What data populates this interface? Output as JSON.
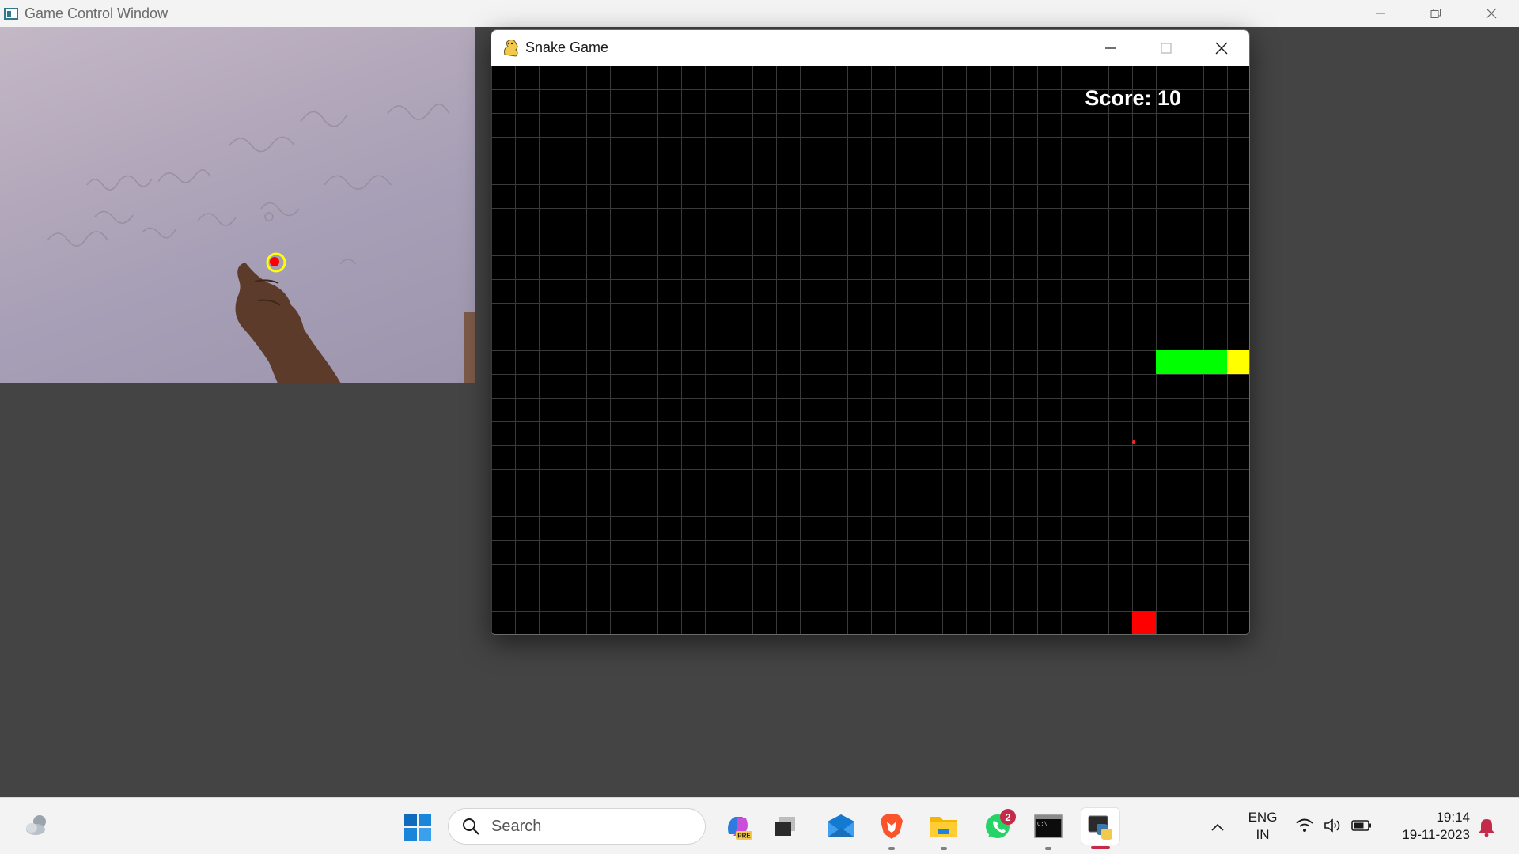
{
  "desktop": {
    "background_color": "#444444"
  },
  "control_window": {
    "title": "Game Control Window",
    "icon": "opencv-window-icon",
    "controls": [
      "minimize-icon",
      "restore-icon",
      "close-icon"
    ]
  },
  "camera_feed": {
    "description_icon": "webcam-feed",
    "tracker_color": "#ffff00",
    "tracker_dot_color": "#ff0000"
  },
  "snake_window": {
    "title": "Snake Game",
    "icon": "pygame-snake-icon",
    "controls": [
      "minimize-icon",
      "maximize-icon",
      "close-icon"
    ],
    "score_label": "Score: 10",
    "colors": {
      "board": "#000000",
      "grid": "#3a3a3a",
      "snake_body": "#00ff00",
      "snake_head": "#ffff00",
      "food": "#ff0000",
      "score_text": "#ffffff"
    }
  },
  "taskbar": {
    "search_placeholder": "Search",
    "apps": [
      {
        "name": "copilot-pre-icon"
      },
      {
        "name": "task-view-icon"
      },
      {
        "name": "mail-icon"
      },
      {
        "name": "brave-icon"
      },
      {
        "name": "file-explorer-icon"
      },
      {
        "name": "whatsapp-icon",
        "badge": "2"
      },
      {
        "name": "terminal-icon"
      },
      {
        "name": "python-icon",
        "active": true
      }
    ],
    "language_line1": "ENG",
    "language_line2": "IN",
    "time": "19:14",
    "date": "19-11-2023",
    "accent_color": "#c42b4a"
  }
}
